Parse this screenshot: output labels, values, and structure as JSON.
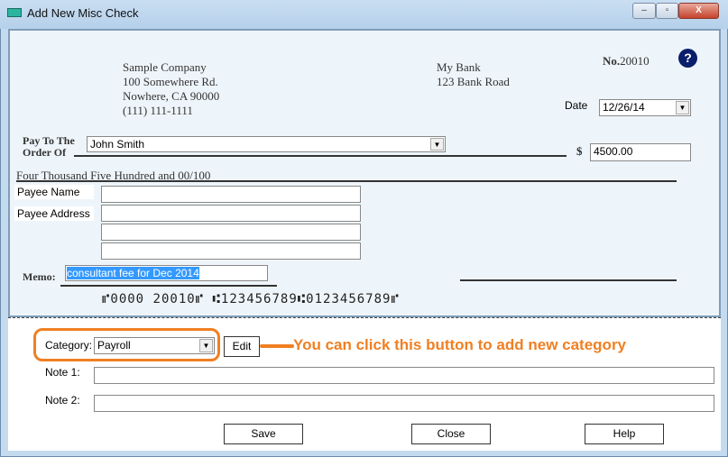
{
  "window": {
    "title": "Add New Misc Check",
    "minimize": "–",
    "maximize": "▫",
    "close": "X"
  },
  "check": {
    "company": [
      "Sample Company",
      "100 Somewhere Rd.",
      "Nowhere, CA 90000",
      "(111) 111-1111"
    ],
    "bank": [
      "My Bank",
      "123 Bank Road"
    ],
    "number_label": "No.",
    "number": "20010",
    "help_icon": "?",
    "date_label": "Date",
    "date": "12/26/14",
    "pay_to_label_1": "Pay To The",
    "pay_to_label_2": "Order Of",
    "payee": "John Smith",
    "dollar_sign": "$",
    "amount": "4500.00",
    "amount_words": "Four Thousand Five Hundred  and 00/100",
    "payee_name_label": "Payee Name",
    "payee_name": "",
    "payee_address_label": "Payee Address",
    "payee_address": [
      "",
      "",
      ""
    ],
    "memo_label": "Memo:",
    "memo": "consultant fee for Dec 2014",
    "micr": "⑈0000 20010⑈ ⑆123456789⑆0123456789⑈"
  },
  "form": {
    "category_label": "Category:",
    "category": "Payroll",
    "edit_label": "Edit",
    "annotation": "You can click this button to add new category",
    "note1_label": "Note 1:",
    "note1": "",
    "note2_label": "Note 2:",
    "note2": "",
    "save_label": "Save",
    "close_label": "Close",
    "help_label": "Help"
  },
  "colors": {
    "annotation": "#f07f22",
    "help_icon": "#0a1f6b",
    "selection": "#3399ff"
  }
}
